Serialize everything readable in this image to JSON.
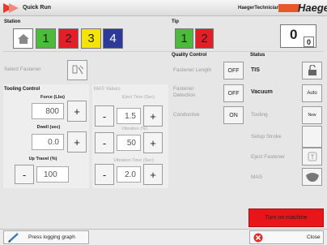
{
  "titlebar": {
    "title": "Quick Run",
    "user": "HaegerTechnician",
    "brand": "Haeger"
  },
  "station": {
    "label": "Station",
    "tiles": [
      "1",
      "2",
      "3",
      "4"
    ]
  },
  "tip": {
    "label": "Tip",
    "tiles": [
      "1",
      "2"
    ],
    "counter_main": "0",
    "counter_sub": "0"
  },
  "fastener": {
    "label": "Select Fastener"
  },
  "tooling": {
    "label": "Tooling Control",
    "force": {
      "label": "Force (Lbs)",
      "value": "800"
    },
    "dwell": {
      "label": "Dwell (sec)",
      "value": "0.0"
    },
    "up_travel": {
      "label": "Up Travel (%)",
      "value": "100"
    }
  },
  "mas": {
    "label": "MAS Values",
    "eject": {
      "label": "Eject Time (Sec)",
      "value": "1.5"
    },
    "vibration": {
      "label": "Vibration (%)",
      "value": "50"
    },
    "vibration_time": {
      "label": "Vibration Time (Sec)",
      "value": "2.0"
    }
  },
  "quality": {
    "label": "Quality Control",
    "rows": [
      {
        "label": "Fastener Length",
        "state": "OFF"
      },
      {
        "label": "Fastener Detection",
        "state": "OFF"
      },
      {
        "label": "Conductive",
        "state": "ON"
      }
    ]
  },
  "status": {
    "label": "Status",
    "rows": [
      {
        "label": "TIS"
      },
      {
        "label": "Vacuum",
        "value": "Auto"
      },
      {
        "label": "Tooling",
        "value": "New"
      },
      {
        "label": "Setup Stroke"
      },
      {
        "label": "Eject Fastener"
      },
      {
        "label": "MAS"
      }
    ]
  },
  "turn_on": {
    "label": "Turn on machine"
  },
  "bottom": {
    "logging": "Press logging graph",
    "close": "Close"
  },
  "colors": {
    "green": "#4cbb3c",
    "red": "#e41e26",
    "yellow": "#f5e400",
    "blue": "#2e3a9a",
    "turn_on": "#e8161b"
  }
}
